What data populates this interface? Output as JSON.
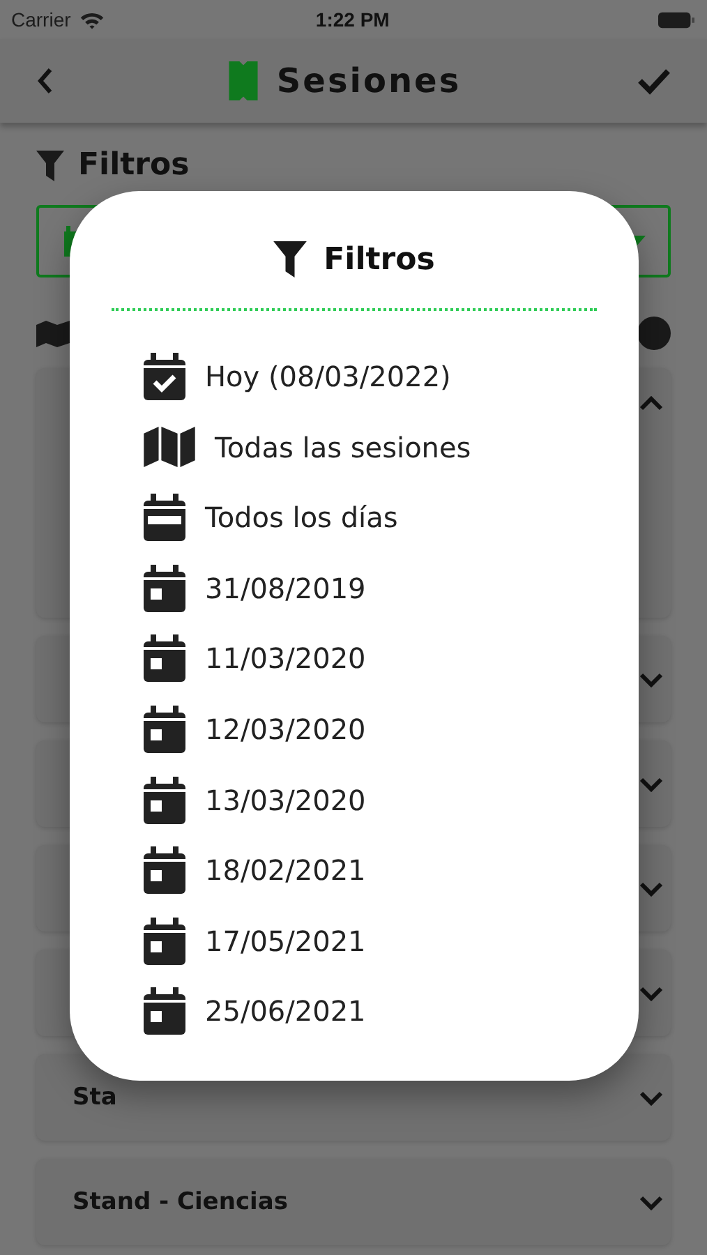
{
  "status_bar": {
    "carrier": "Carrier",
    "time": "1:22 PM"
  },
  "nav": {
    "title": "Sesiones"
  },
  "filters_heading": "Filtros",
  "background_cards": [
    {
      "expanded": true
    },
    {
      "expanded": false
    },
    {
      "expanded": false
    },
    {
      "expanded": false
    },
    {
      "expanded": false
    },
    {
      "label": "Sta",
      "expanded": false
    },
    {
      "label": "Stand - Ciencias",
      "expanded": false
    }
  ],
  "modal": {
    "title": "Filtros",
    "items": [
      {
        "label": "Hoy (08/03/2022)",
        "kind": "today"
      },
      {
        "label": "Todas las sesiones",
        "kind": "map"
      },
      {
        "label": "Todos los días",
        "kind": "week"
      },
      {
        "label": "31/08/2019",
        "kind": "day"
      },
      {
        "label": "11/03/2020",
        "kind": "day"
      },
      {
        "label": "12/03/2020",
        "kind": "day"
      },
      {
        "label": "13/03/2020",
        "kind": "day"
      },
      {
        "label": "18/02/2021",
        "kind": "day"
      },
      {
        "label": "17/05/2021",
        "kind": "day"
      },
      {
        "label": "25/06/2021",
        "kind": "day"
      }
    ]
  }
}
